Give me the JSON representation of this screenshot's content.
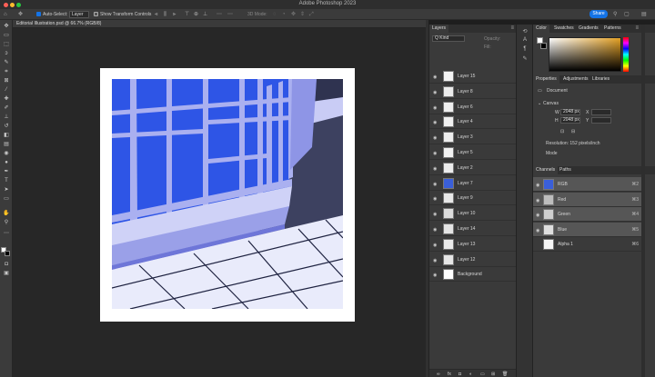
{
  "window": {
    "title": "Adobe Photoshop 2023"
  },
  "options_bar": {
    "auto_select_label": "Auto-Select:",
    "auto_select_value": "Layer",
    "show_transform_label": "Show Transform Controls",
    "mode_3d_label": "3D Mode:",
    "share_label": "Share"
  },
  "document": {
    "tab_label": "Editorial Illustration.psd @ 66.7% (RGB/8)"
  },
  "layers_panel": {
    "tab_label": "Layers",
    "kind_label": "Q Kind",
    "opacity_label": "Opacity:",
    "fill_label": "Fill:",
    "layers": [
      {
        "name": "Layer 15",
        "thumb": "#f4f4f4"
      },
      {
        "name": "Layer 8",
        "thumb": "#ececec"
      },
      {
        "name": "Layer 6",
        "thumb": "#efefef"
      },
      {
        "name": "Layer 4",
        "thumb": "#f0f0f0"
      },
      {
        "name": "Layer 3",
        "thumb": "#eeeeee"
      },
      {
        "name": "Layer 5",
        "thumb": "#f1f1f1"
      },
      {
        "name": "Layer 2",
        "thumb": "#ededed"
      },
      {
        "name": "Layer 7",
        "thumb": "#3a5fd9"
      },
      {
        "name": "Layer 9",
        "thumb": "#e8e8e8"
      },
      {
        "name": "Layer 10",
        "thumb": "#dcdcdc"
      },
      {
        "name": "Layer 14",
        "thumb": "#e4e4e4"
      },
      {
        "name": "Layer 13",
        "thumb": "#eaeaea"
      },
      {
        "name": "Layer 12",
        "thumb": "#e6e6e6"
      },
      {
        "name": "Background",
        "thumb": "#ffffff"
      }
    ]
  },
  "color_panel": {
    "tabs": [
      "Color",
      "Swatches",
      "Gradients",
      "Patterns"
    ],
    "hue_color": "#e3a024"
  },
  "properties_panel": {
    "tabs": [
      "Properties",
      "Adjustments",
      "Libraries"
    ],
    "document_label": "Document",
    "canvas_label": "Canvas",
    "w_label": "W",
    "w_value": "2048 px",
    "h_label": "H",
    "h_value": "2048 px",
    "x_label": "X",
    "y_label": "Y",
    "resolution_label": "Resolution: 152 pixels/inch",
    "mode_label": "Mode"
  },
  "channels_panel": {
    "tabs": [
      "Channels",
      "Paths"
    ],
    "channels": [
      {
        "name": "RGB",
        "key": "⌘2",
        "thumb": "#3a5fd9"
      },
      {
        "name": "Red",
        "key": "⌘3",
        "thumb": "#bdbdbd"
      },
      {
        "name": "Green",
        "key": "⌘4",
        "thumb": "#cfcfcf"
      },
      {
        "name": "Blue",
        "key": "⌘5",
        "thumb": "#dedede"
      },
      {
        "name": "Alpha 1",
        "key": "⌘6",
        "thumb": "#f5f5f5"
      }
    ]
  },
  "artwork": {
    "blue": "#2e55e6",
    "frame": "#aab0f0",
    "shadow": "#3d4160",
    "floor": "#e9ebfb"
  }
}
